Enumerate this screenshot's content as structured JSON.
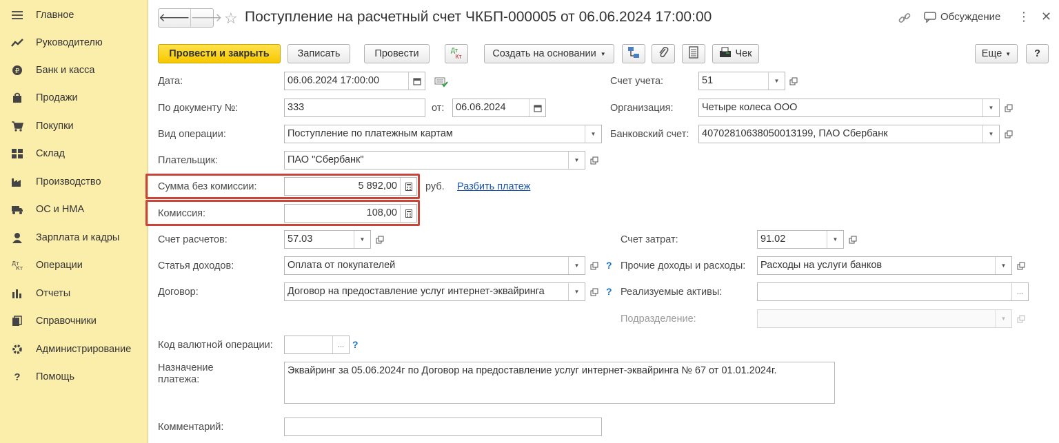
{
  "sidebar": {
    "items": [
      {
        "label": "Главное",
        "icon": "menu-icon"
      },
      {
        "label": "Руководителю",
        "icon": "trend-icon"
      },
      {
        "label": "Банк и касса",
        "icon": "coin-icon"
      },
      {
        "label": "Продажи",
        "icon": "bag-icon"
      },
      {
        "label": "Покупки",
        "icon": "cart-icon"
      },
      {
        "label": "Склад",
        "icon": "warehouse-icon"
      },
      {
        "label": "Производство",
        "icon": "factory-icon"
      },
      {
        "label": "ОС и НМА",
        "icon": "truck-icon"
      },
      {
        "label": "Зарплата и кадры",
        "icon": "person-icon"
      },
      {
        "label": "Операции",
        "icon": "dt-kt-icon"
      },
      {
        "label": "Отчеты",
        "icon": "bar-chart-icon"
      },
      {
        "label": "Справочники",
        "icon": "books-icon"
      },
      {
        "label": "Администрирование",
        "icon": "gear-icon"
      },
      {
        "label": "Помощь",
        "icon": "question-icon"
      }
    ]
  },
  "header": {
    "title": "Поступление на расчетный счет ЧКБП-000005 от 06.06.2024 17:00:00",
    "discussion_label": "Обсуждение",
    "back_arrow": "🡐",
    "forward_arrow": "🡒"
  },
  "toolbar": {
    "post_close": "Провести и закрыть",
    "save": "Записать",
    "post": "Провести",
    "dt_kt_top": "Дт",
    "dt_kt_bottom": "Кт",
    "create_based": "Создать на основании",
    "check": "Чек",
    "more": "Еще",
    "help": "?"
  },
  "form": {
    "date": {
      "label": "Дата:",
      "value": "06.06.2024 17:00:00"
    },
    "doc_number": {
      "label": "По документу №:",
      "value": "333"
    },
    "doc_from": {
      "label": "от:",
      "value": "06.06.2024"
    },
    "operation_type": {
      "label": "Вид операции:",
      "value": "Поступление по платежным картам"
    },
    "payer": {
      "label": "Плательщик:",
      "value": "ПАО \"Сбербанк\""
    },
    "amount": {
      "label": "Сумма без комиссии:",
      "value": "5 892,00",
      "currency": "руб.",
      "split_link": "Разбить платеж"
    },
    "commission": {
      "label": "Комиссия:",
      "value": "108,00"
    },
    "settlement_account": {
      "label": "Счет расчетов:",
      "value": "57.03"
    },
    "income_item": {
      "label": "Статья доходов:",
      "value": "Оплата от покупателей"
    },
    "contract": {
      "label": "Договор:",
      "value": "Договор на предоставление услуг интернет-эквайринга"
    },
    "currency_op_code": {
      "label": "Код валютной операции:",
      "value": ""
    },
    "purpose": {
      "label_line1": "Назначение",
      "label_line2": "платежа:",
      "value": "Эквайринг за 05.06.2024г по Договор на предоставление услуг интернет-эквайринга № 67 от 01.01.2024г."
    },
    "comment": {
      "label": "Комментарий:",
      "value": ""
    },
    "account": {
      "label": "Счет учета:",
      "value": "51"
    },
    "organization": {
      "label": "Организация:",
      "value": "Четыре колеса ООО"
    },
    "bank_account": {
      "label": "Банковский счет:",
      "value": "40702810638050013199, ПАО Сбербанк"
    },
    "cost_account": {
      "label": "Счет затрат:",
      "value": "91.02"
    },
    "other_income_expense": {
      "label": "Прочие доходы и расходы:",
      "value": "Расходы на услуги банков"
    },
    "realized_assets": {
      "label": "Реализуемые активы:",
      "value": ""
    },
    "division": {
      "label": "Подразделение:",
      "value": ""
    }
  },
  "colors": {
    "sidebar_bg": "#fbedaa",
    "primary_button": "#f7c800",
    "highlight_border": "#c8453a",
    "link": "#1a55a8",
    "help_mark": "#1a73c1"
  }
}
